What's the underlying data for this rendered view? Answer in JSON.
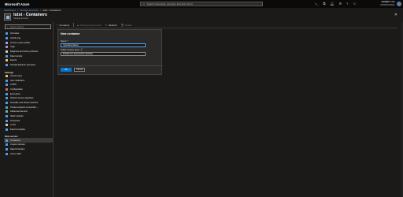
{
  "topbar": {
    "brand": "Microsoft Azure",
    "search_placeholder": "Search resources, services, and docs (G+/)",
    "user_name": "mail@fic.com",
    "user_dir": "PROFESSIONAL"
  },
  "breadcrumb": {
    "items": [
      "Dashboard",
      "Storage accounts",
      "tutst - Containers"
    ]
  },
  "header": {
    "title": "tutst - Containers",
    "subtitle": "Storage account"
  },
  "sidebar": {
    "search_placeholder": "Search (Ctrl+/)",
    "items_top": [
      {
        "label": "Overview",
        "color": "#4ea0f0"
      },
      {
        "label": "Activity log",
        "color": "#4ea0f0"
      },
      {
        "label": "Access control (IAM)",
        "color": "#9aa7f5"
      },
      {
        "label": "Tags",
        "color": "#b58bd8"
      },
      {
        "label": "Diagnose and solve problems",
        "color": "#cccccc"
      },
      {
        "label": "Data transfer",
        "color": "#4ea0f0"
      },
      {
        "label": "Events",
        "color": "#f2c94c"
      },
      {
        "label": "Storage Explorer (preview)",
        "color": "#4ea0f0"
      }
    ],
    "settings_label": "Settings",
    "items_settings": [
      {
        "label": "Access keys",
        "color": "#f2c94c"
      },
      {
        "label": "Geo-replication",
        "color": "#4ea0f0"
      },
      {
        "label": "CORS",
        "color": "#4ea0f0"
      },
      {
        "label": "Configuration",
        "color": "#e06c3a"
      },
      {
        "label": "Encryption",
        "color": "#4ea0f0"
      },
      {
        "label": "Shared access signature",
        "color": "#4ea0f0"
      },
      {
        "label": "Firewalls and virtual networks",
        "color": "#4ea0f0"
      },
      {
        "label": "Private endpoint connection...",
        "color": "#4ea0f0"
      },
      {
        "label": "Advanced security",
        "color": "#6fbf73"
      },
      {
        "label": "Static website",
        "color": "#4ea0f0"
      },
      {
        "label": "Properties",
        "color": "#4ea0f0"
      },
      {
        "label": "Locks",
        "color": "#cccccc"
      },
      {
        "label": "Export template",
        "color": "#4ea0f0"
      }
    ],
    "blob_label": "Blob service",
    "items_blob": [
      {
        "label": "Containers",
        "color": "#4ea0f0",
        "active": true
      },
      {
        "label": "Custom domain",
        "color": "#4ea0f0"
      },
      {
        "label": "Data Protection",
        "color": "#4ea0f0"
      },
      {
        "label": "Azure CDN",
        "color": "#4ea0f0"
      }
    ]
  },
  "toolbar": {
    "container": "Container",
    "change_access": "Change access level",
    "refresh": "Refresh",
    "delete": "Delete"
  },
  "panel": {
    "title": "New container",
    "name_label": "Name *",
    "name_value": "mytutstcontainer",
    "access_label": "Public access level",
    "access_value": "Private (no anonymous access)",
    "ok": "OK",
    "cancel": "Cancel"
  }
}
